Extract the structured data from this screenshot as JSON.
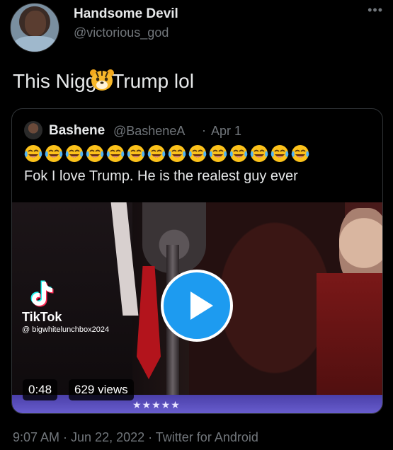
{
  "author": {
    "display_name": "Handsome Devil",
    "handle": "@victorious_god"
  },
  "more_menu_glyph": "•••",
  "tweet": {
    "text_before": "This Nigg",
    "emoji": "tiger-face",
    "text_after": "Trump lol"
  },
  "quote": {
    "display_name": "Bashene",
    "handle": "@BasheneA",
    "separator": "·",
    "date": "Apr 1",
    "emoji_count": 14,
    "emoji_name": "face-with-tears-of-joy",
    "text": "Fok I love Trump. He is the realest guy ever",
    "media": {
      "watermark_brand": "TikTok",
      "watermark_user": "@ bigwhitelunchbox2024",
      "duration": "0:48",
      "views": "629 views",
      "stars": "★★★★★"
    }
  },
  "footer": "9:07 AM · Jun 22, 2022 · Twitter for Android",
  "colors": {
    "background": "#000000",
    "primary_text": "#e7e9ea",
    "secondary_text": "#71767b",
    "accent": "#1d9bf0",
    "border": "#2f3336"
  }
}
